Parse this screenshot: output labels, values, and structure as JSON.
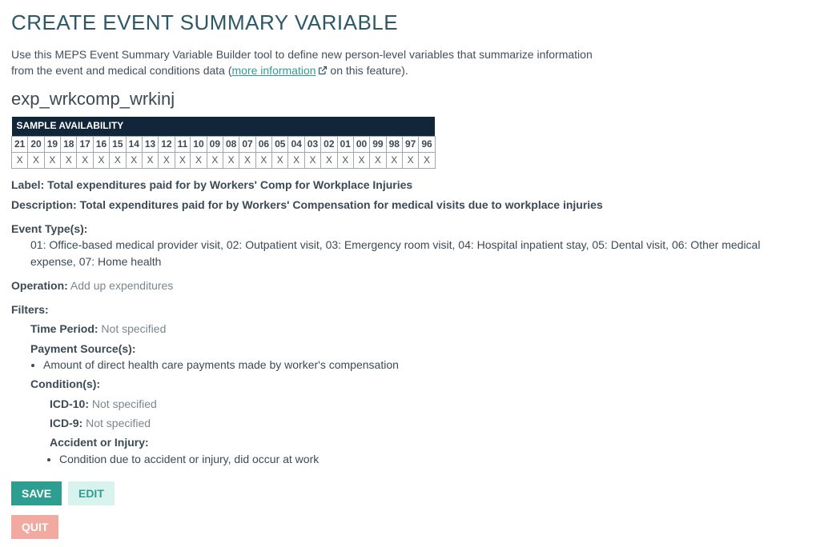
{
  "title": "CREATE EVENT SUMMARY VARIABLE",
  "intro_pre": "Use this MEPS Event Summary Variable Builder tool to define new person-level variables that summarize information from the event and medical conditions data (",
  "intro_link": "more information",
  "intro_post": " on this feature).",
  "variable_name": "exp_wrkcomp_wrkinj",
  "sample": {
    "header": "SAMPLE AVAILABILITY",
    "years": [
      "21",
      "20",
      "19",
      "18",
      "17",
      "16",
      "15",
      "14",
      "13",
      "12",
      "11",
      "10",
      "09",
      "08",
      "07",
      "06",
      "05",
      "04",
      "03",
      "02",
      "01",
      "00",
      "99",
      "98",
      "97",
      "96"
    ],
    "marks": [
      "X",
      "X",
      "X",
      "X",
      "X",
      "X",
      "X",
      "X",
      "X",
      "X",
      "X",
      "X",
      "X",
      "X",
      "X",
      "X",
      "X",
      "X",
      "X",
      "X",
      "X",
      "X",
      "X",
      "X",
      "X",
      "X"
    ]
  },
  "label_label": "Label:",
  "label_value": " Total expenditures paid for by Workers' Comp for Workplace Injuries",
  "desc_label": "Description:",
  "desc_value": " Total expenditures paid for by Workers' Compensation for medical visits due to workplace injuries",
  "evtypes_label": "Event Type(s):",
  "evtypes_value": "01: Office-based medical provider visit, 02: Outpatient visit, 03: Emergency room visit, 04: Hospital inpatient stay, 05: Dental visit, 06: Other medical expense, 07: Home health",
  "op_label": "Operation:",
  "op_value": " Add up expenditures",
  "filters_label": "Filters:",
  "time_label": "Time Period:",
  "time_value": " Not specified",
  "pay_label": "Payment Source(s):",
  "pay_item": "Amount of direct health care payments made by worker's compensation",
  "cond_label": "Condition(s):",
  "icd10_label": "ICD-10:",
  "icd10_value": " Not specified",
  "icd9_label": "ICD-9:",
  "icd9_value": " Not specified",
  "acc_label": "Accident or Injury:",
  "acc_item": "Condition due to accident or injury, did occur at work",
  "buttons": {
    "save": "SAVE",
    "edit": "EDIT",
    "quit": "QUIT"
  }
}
